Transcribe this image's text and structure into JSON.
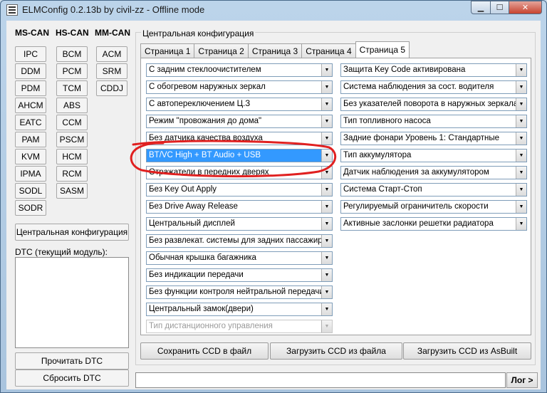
{
  "window": {
    "title": "ELMConfig 0.2.13b by civil-zz - Offline mode"
  },
  "categories": {
    "ms_can": {
      "label": "MS-CAN",
      "modules": [
        "IPC",
        "DDM",
        "PDM",
        "AHCM",
        "EATC",
        "PAM",
        "KVM",
        "IPMA",
        "SODL",
        "SODR"
      ]
    },
    "hs_can": {
      "label": "HS-CAN",
      "modules": [
        "BCM",
        "PCM",
        "TCM",
        "ABS",
        "CCM",
        "PSCM",
        "HCM",
        "RCM",
        "SASM"
      ]
    },
    "mm_can": {
      "label": "MM-CAN",
      "modules": [
        "ACM",
        "SRM",
        "CDDJ"
      ]
    }
  },
  "central_config_button": "Центральная конфигурация",
  "dtc": {
    "label": "DTC (текущий модуль):",
    "read_button": "Прочитать DTC",
    "reset_button": "Сбросить DTC"
  },
  "group_title": "Центральная конфигурация",
  "tabs": [
    "Страница 1",
    "Страница 2",
    "Страница 3",
    "Страница 4",
    "Страница 5"
  ],
  "active_tab": "Страница 5",
  "left_column": [
    "С задним стеклоочистителем",
    "С обогревом наружных зеркал",
    "С автопереключением Ц.З",
    "Режим \"провожания до дома\"",
    "Без датчика качества воздуха",
    "BT/VC High + BT Audio + USB",
    "Отражатели в передних дверях",
    "Без Key Out Apply",
    "Без Drive Away Release",
    "Центральный дисплей",
    "Без развлекат. системы для задних пассажиров",
    "Обычная крышка багажника",
    "Без индикации передачи",
    "Без функции контроля нейтральной передачи",
    "Центральный замок(двери)",
    "Тип дистанционного управления"
  ],
  "selected_index": 5,
  "disabled_index": 15,
  "right_column": [
    "Защита Key Code активирована",
    "Система наблюдения за сост. водителя",
    "Без указателей поворота в наружных зеркалах",
    "Тип топливного насоса",
    "Задние фонари Уровень 1: Стандартные",
    "Тип аккумулятора",
    "Датчик наблюдения за аккумулятором",
    "Система Старт-Стоп",
    "Регулируемый ограничитель скорости",
    "Активные заслонки решетки радиатора"
  ],
  "actions": {
    "save": "Сохранить CCD в файл",
    "load": "Загрузить CCD из файла",
    "load_asbuilt": "Загрузить CCD из AsBuilt"
  },
  "log_button": "Лог >",
  "colors": {
    "selection": "#3399ff",
    "annotation": "#e02020"
  }
}
